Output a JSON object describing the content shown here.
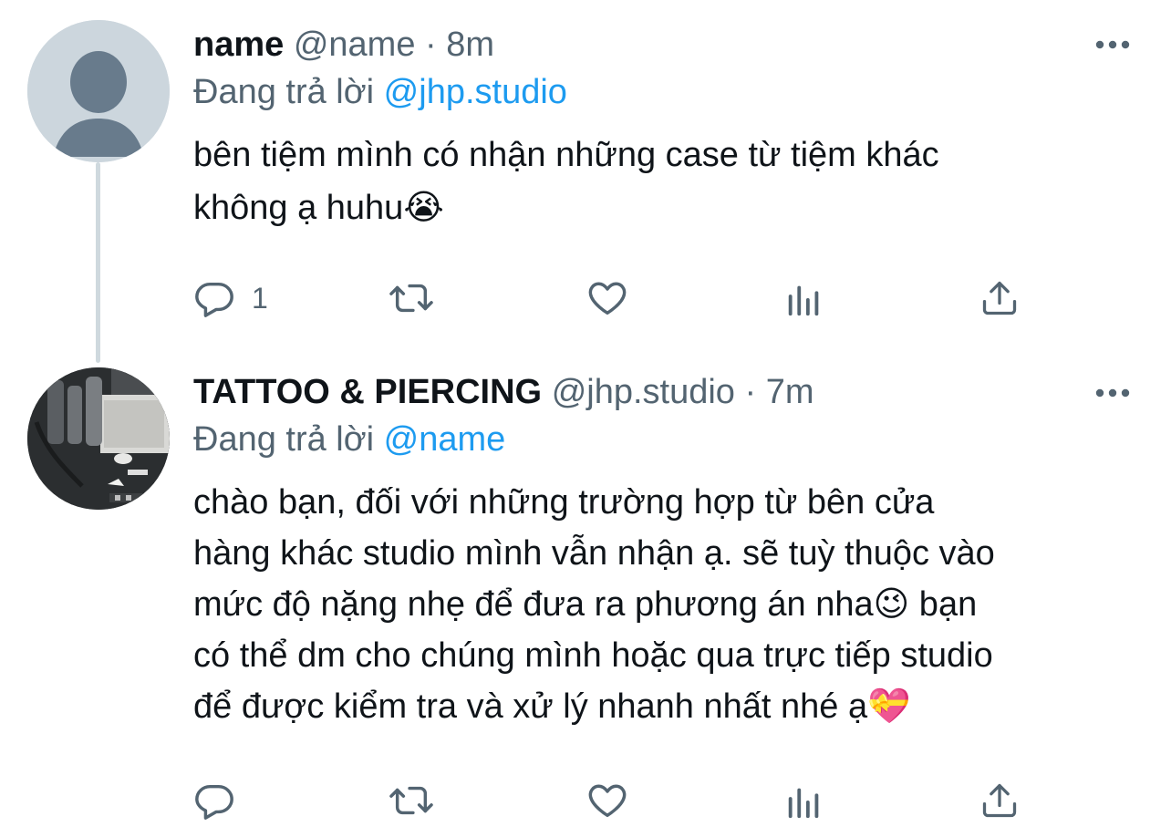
{
  "tweets": [
    {
      "display_name": "name",
      "handle": "@name",
      "separator": "·",
      "time": "8m",
      "reply_prefix": "Đang trả lời",
      "reply_to": "@jhp.studio",
      "text_lines": [
        "bên tiệm mình có nhận những case từ tiệm khác",
        "không ạ huhu😭"
      ],
      "reply_count": "1",
      "icons": [
        "default-avatar-icon",
        "more-dots-icon",
        "reply-icon",
        "retweet-icon",
        "like-icon",
        "analytics-icon",
        "share-icon"
      ]
    },
    {
      "display_name": "TATTOO & PIERCING",
      "handle": "@jhp.studio",
      "separator": "·",
      "time": "7m",
      "reply_prefix": "Đang trả lời",
      "reply_to": "@name",
      "text_lines": [
        "chào bạn, đối với những trường hợp từ bên cửa",
        "hàng khác studio mình vẫn nhận ạ. sẽ tuỳ thuộc vào",
        "mức độ nặng nhẹ để đưa ra phương án nha😉  bạn",
        "có thể dm cho chúng mình hoặc qua trực tiếp studio",
        "để được kiểm tra và xử lý nhanh nhất nhé ạ💝"
      ],
      "reply_count": "",
      "icons": [
        "studio-photo-avatar",
        "more-dots-icon",
        "reply-icon",
        "retweet-icon",
        "like-icon",
        "analytics-icon",
        "share-icon"
      ]
    }
  ],
  "colors": {
    "text": "#0f1419",
    "secondary": "#536471",
    "link": "#1d9bf0",
    "thread_line": "#cfd9de",
    "default_avatar_bg": "#ccd6dd",
    "default_avatar_fg": "#687b8c"
  }
}
